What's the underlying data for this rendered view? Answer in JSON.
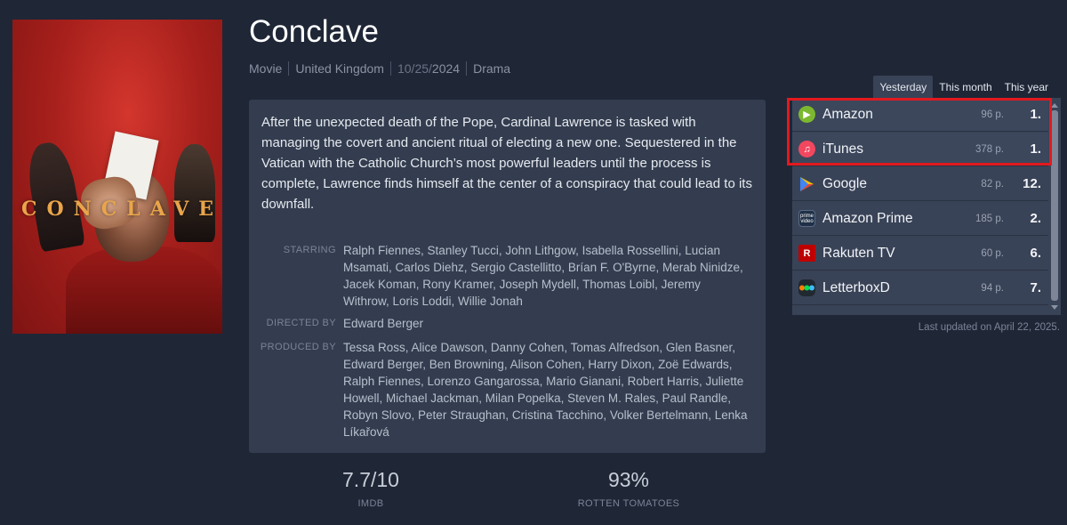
{
  "movie": {
    "title": "Conclave",
    "type": "Movie",
    "country": "United Kingdom",
    "date_prefix": "10/25/",
    "date_year": "2024",
    "genre": "Drama",
    "poster_title": "CONCLAVE",
    "synopsis": "After the unexpected death of the Pope, Cardinal Lawrence is tasked with managing the covert and ancient ritual of electing a new one. Sequestered in the Vatican with the Catholic Church’s most powerful leaders until the process is complete, Lawrence finds himself at the center of a conspiracy that could lead to its downfall."
  },
  "credits": {
    "starring_label": "STARRING",
    "starring": "Ralph Fiennes, Stanley Tucci, John Lithgow, Isabella Rossellini, Lucian Msamati, Carlos Diehz, Sergio Castellitto, Brían F. O'Byrne, Merab Ninidze, Jacek Koman, Rony Kramer, Joseph Mydell, Thomas Loibl, Jeremy Withrow, Loris Loddi, Willie Jonah",
    "directed_label": "DIRECTED BY",
    "directed": "Edward Berger",
    "produced_label": "PRODUCED BY",
    "produced": "Tessa Ross, Alice Dawson, Danny Cohen, Tomas Alfredson, Glen Basner, Edward Berger, Ben Browning, Alison Cohen, Harry Dixon, Zoë Edwards, Ralph Fiennes, Lorenzo Gangarossa, Mario Gianani, Robert Harris, Juliette Howell, Michael Jackman, Milan Popelka, Steven M. Rales, Paul Randle, Robyn Slovo, Peter Straughan, Cristina Tacchino, Volker Bertelmann, Lenka Líkařová"
  },
  "ratings": {
    "imdb_score": "7.7/10",
    "imdb_label": "IMDB",
    "rt_score": "93%",
    "rt_label": "ROTTEN TOMATOES"
  },
  "chart": {
    "tabs": [
      "Yesterday",
      "This month",
      "This year"
    ],
    "active_tab": "Yesterday",
    "rows": [
      {
        "service": "Amazon",
        "points": "96 p.",
        "rank": "1.",
        "icon": "amazon-play-icon",
        "color": "#7cb82f"
      },
      {
        "service": "iTunes",
        "points": "378 p.",
        "rank": "1.",
        "icon": "itunes-icon",
        "color": "#f2475f"
      },
      {
        "service": "Google",
        "points": "82 p.",
        "rank": "12.",
        "icon": "google-play-icon",
        "color": "#34a853"
      },
      {
        "service": "Amazon Prime",
        "points": "185 p.",
        "rank": "2.",
        "icon": "prime-video-icon",
        "color": "#1f2f46"
      },
      {
        "service": "Rakuten TV",
        "points": "60 p.",
        "rank": "6.",
        "icon": "rakuten-icon",
        "color": "#bf0000"
      },
      {
        "service": "LetterboxD",
        "points": "94 p.",
        "rank": "7.",
        "icon": "letterboxd-icon",
        "color": "#2c3440"
      }
    ],
    "last_updated": "Last updated on April 22, 2025."
  }
}
